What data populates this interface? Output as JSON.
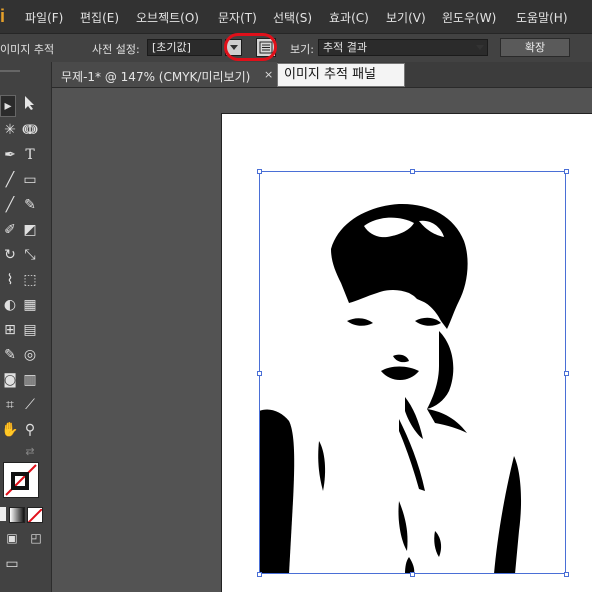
{
  "menubar": {
    "logo": "i",
    "items": [
      "파일(F)",
      "편집(E)",
      "오브젝트(O)",
      "문자(T)",
      "선택(S)",
      "효과(C)",
      "보기(V)",
      "윈도우(W)",
      "도움말(H)"
    ]
  },
  "control": {
    "title": "이미지 추적",
    "preset_label": "사전 설정:",
    "preset_value": "[초기값]",
    "view_label": "보기:",
    "view_value": "추적 결과",
    "expand_label": "확장"
  },
  "tab": {
    "label": "무제-1* @ 147% (CMYK/미리보기)",
    "close": "×"
  },
  "tooltip": "이미지 추적 패널",
  "icons": {
    "selection": "selection-arrow-icon",
    "direct": "direct-selection-icon",
    "panel": "image-trace-panel-icon"
  },
  "colors": {
    "highlight": "#e0101a",
    "selection": "#4a6fd6",
    "brand": "#e6a02a"
  }
}
